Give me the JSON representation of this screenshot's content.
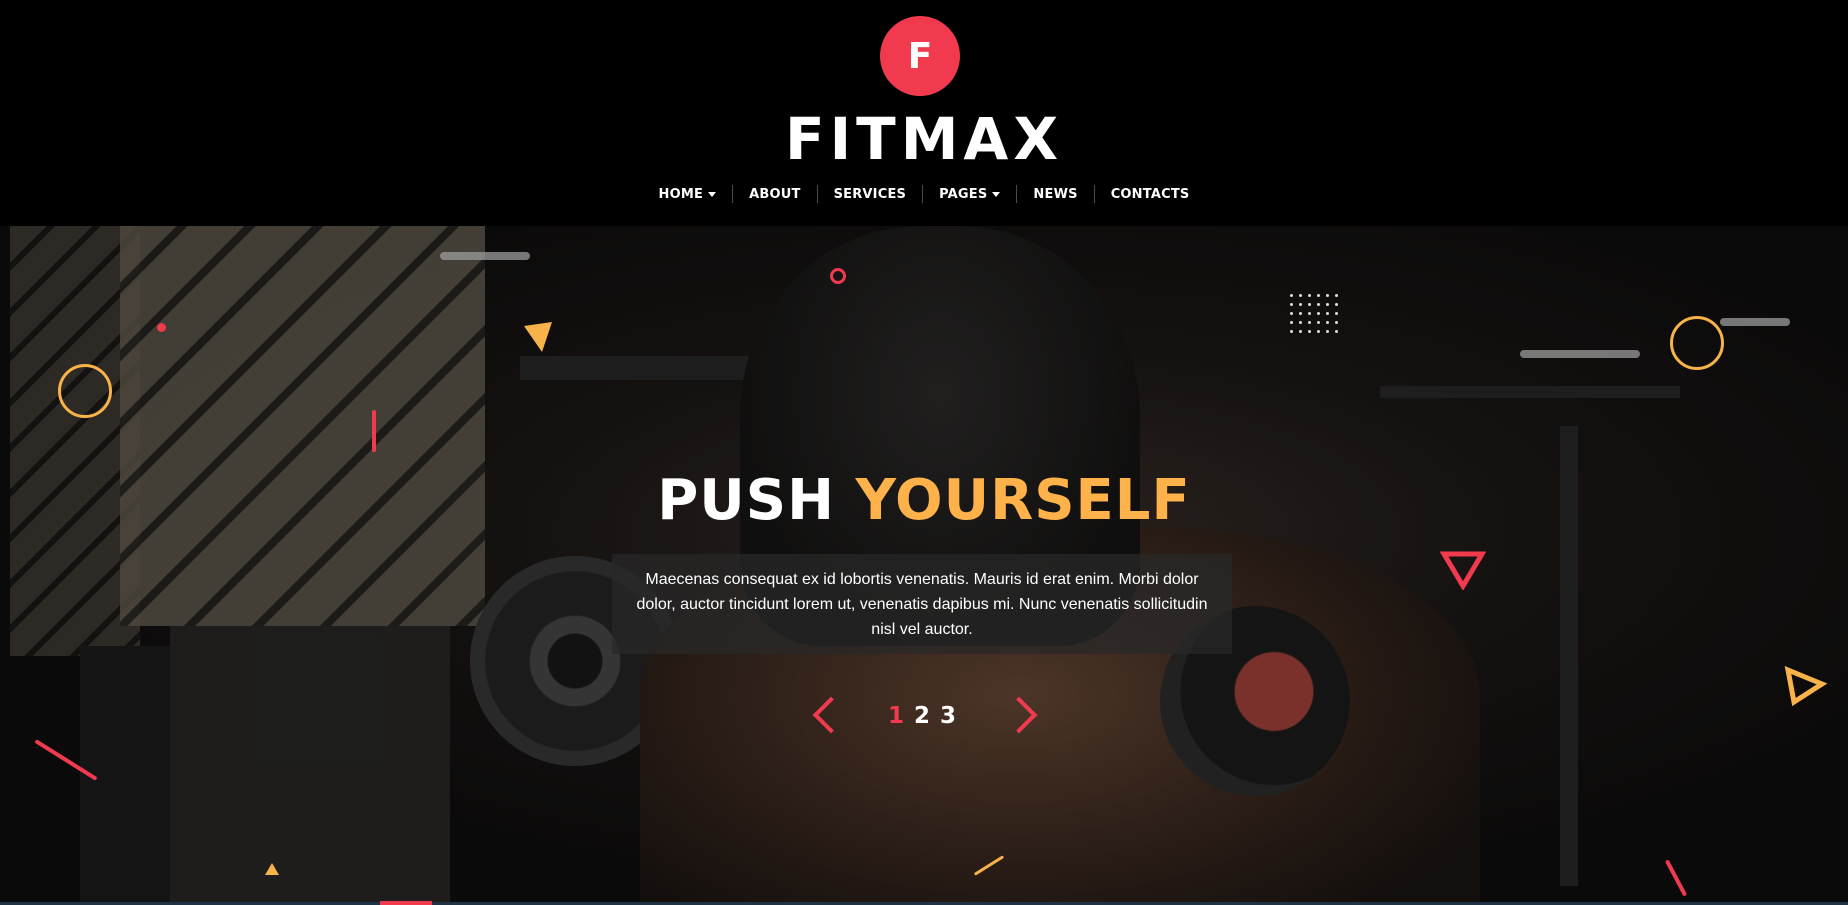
{
  "brand": {
    "logo_letter": "F",
    "logo_word": "FITMAX",
    "logo_color": "#f23a4e"
  },
  "nav": {
    "items": [
      {
        "label": "HOME",
        "dropdown": true
      },
      {
        "label": "ABOUT",
        "dropdown": false
      },
      {
        "label": "SERVICES",
        "dropdown": false
      },
      {
        "label": "PAGES",
        "dropdown": true
      },
      {
        "label": "NEWS",
        "dropdown": false
      },
      {
        "label": "CONTACTS",
        "dropdown": false
      }
    ]
  },
  "hero": {
    "title_part1": "PUSH",
    "title_part2": "YOURSELF",
    "title_accent_color": "#ffb14a",
    "description": "Maecenas consequat ex id lobortis venenatis. Mauris id erat enim. Morbi dolor dolor, auctor tincidunt lorem ut, venenatis dapibus mi. Nunc venenatis sollicitudin nisl vel auctor."
  },
  "slider": {
    "pages": [
      "1",
      "2",
      "3"
    ],
    "active_page": "1",
    "arrow_color": "#f23a4e"
  },
  "icons": {
    "prev": "chevron-left-icon",
    "next": "chevron-right-icon",
    "dropdown": "caret-down-icon"
  }
}
